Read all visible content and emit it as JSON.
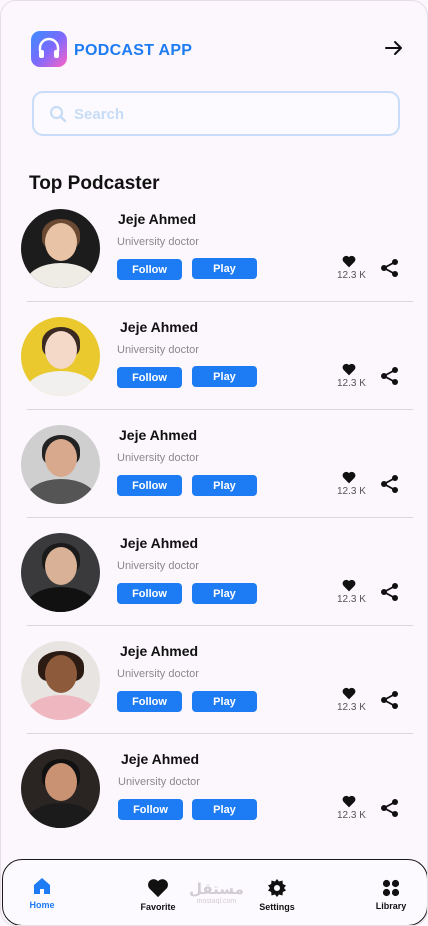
{
  "header": {
    "app_title": "PODCAST APP",
    "logo_icon": "headphones-icon",
    "action_icon": "arrow-right-icon"
  },
  "search": {
    "placeholder": "Search"
  },
  "section": {
    "title": "Top Podcaster"
  },
  "colors": {
    "accent": "#1d7bf3",
    "background": "#fcf6fd"
  },
  "podcasters": [
    {
      "name": "Jeje Ahmed",
      "role": "University doctor",
      "follow_label": "Follow",
      "play_label": "Play",
      "likes": "12.3 K"
    },
    {
      "name": "Jeje Ahmed",
      "role": "University doctor",
      "follow_label": "Follow",
      "play_label": "Play",
      "likes": "12.3 K"
    },
    {
      "name": "Jeje Ahmed",
      "role": "University doctor",
      "follow_label": "Follow",
      "play_label": "Play",
      "likes": "12.3 K"
    },
    {
      "name": "Jeje Ahmed",
      "role": "University doctor",
      "follow_label": "Follow",
      "play_label": "Play",
      "likes": "12.3 K"
    },
    {
      "name": "Jeje Ahmed",
      "role": "University doctor",
      "follow_label": "Follow",
      "play_label": "Play",
      "likes": "12.3 K"
    },
    {
      "name": "Jeje Ahmed",
      "role": "University doctor",
      "follow_label": "Follow",
      "play_label": "Play",
      "likes": "12.3 K"
    }
  ],
  "nav": {
    "items": [
      {
        "label": "Home",
        "icon": "home-icon",
        "active": true
      },
      {
        "label": "Favorite",
        "icon": "heart-icon",
        "active": false
      },
      {
        "label": "Settings",
        "icon": "gear-icon",
        "active": false
      },
      {
        "label": "Library",
        "icon": "grid-icon",
        "active": false
      }
    ]
  },
  "watermark": {
    "text": "مستقل",
    "sub": "mostaql.com"
  }
}
